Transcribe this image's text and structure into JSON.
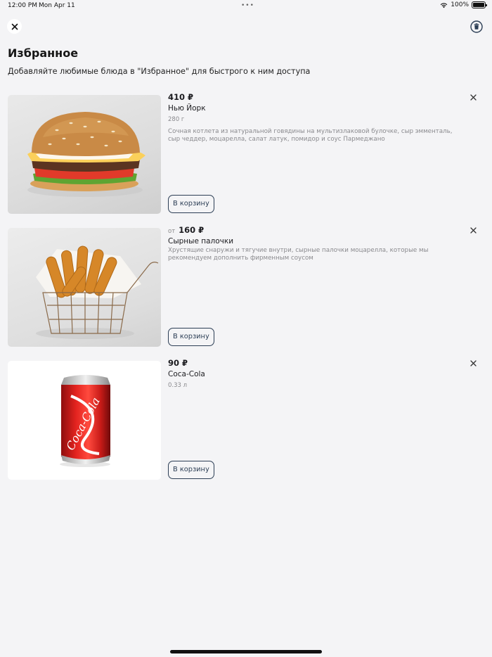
{
  "status_bar": {
    "time": "12:00 PM",
    "date": "Mon Apr 11",
    "battery": "100%",
    "icons": [
      "wifi-icon",
      "battery-icon"
    ]
  },
  "header": {
    "close_icon": "close-icon",
    "trash_icon": "trash-icon",
    "title": "Избранное",
    "subtitle": "Добавляйте любимые блюда в \"Избранное\" для быстрого к ним доступа"
  },
  "items": [
    {
      "price_prefix": "",
      "price": "410 ₽",
      "name": "Нью Йорк",
      "meta": "280 г",
      "description": "Сочная котлета из натуральной говядины на мультизлаковой булочке, сыр эмменталь, сыр чеддер, моцарелла, салат латук, помидор и соус Пармеджано",
      "button": "В корзину",
      "image": "burger-image"
    },
    {
      "price_prefix": "от",
      "price": "160 ₽",
      "name": "Сырные палочки",
      "meta": "",
      "description": "Хрустящие снаружи и тягучие внутри, сырные палочки моцарелла, которые мы рекомендуем дополнить фирменным соусом",
      "button": "В корзину",
      "image": "cheese-sticks-image"
    },
    {
      "price_prefix": "",
      "price": "90 ₽",
      "name": "Coca-Cola",
      "meta": "0.33 л",
      "description": "",
      "button": "В корзину",
      "image": "coca-cola-image"
    }
  ],
  "colors": {
    "background": "#f4f4f6",
    "button_border": "#2c3e55",
    "muted_text": "#8a8a8e"
  }
}
